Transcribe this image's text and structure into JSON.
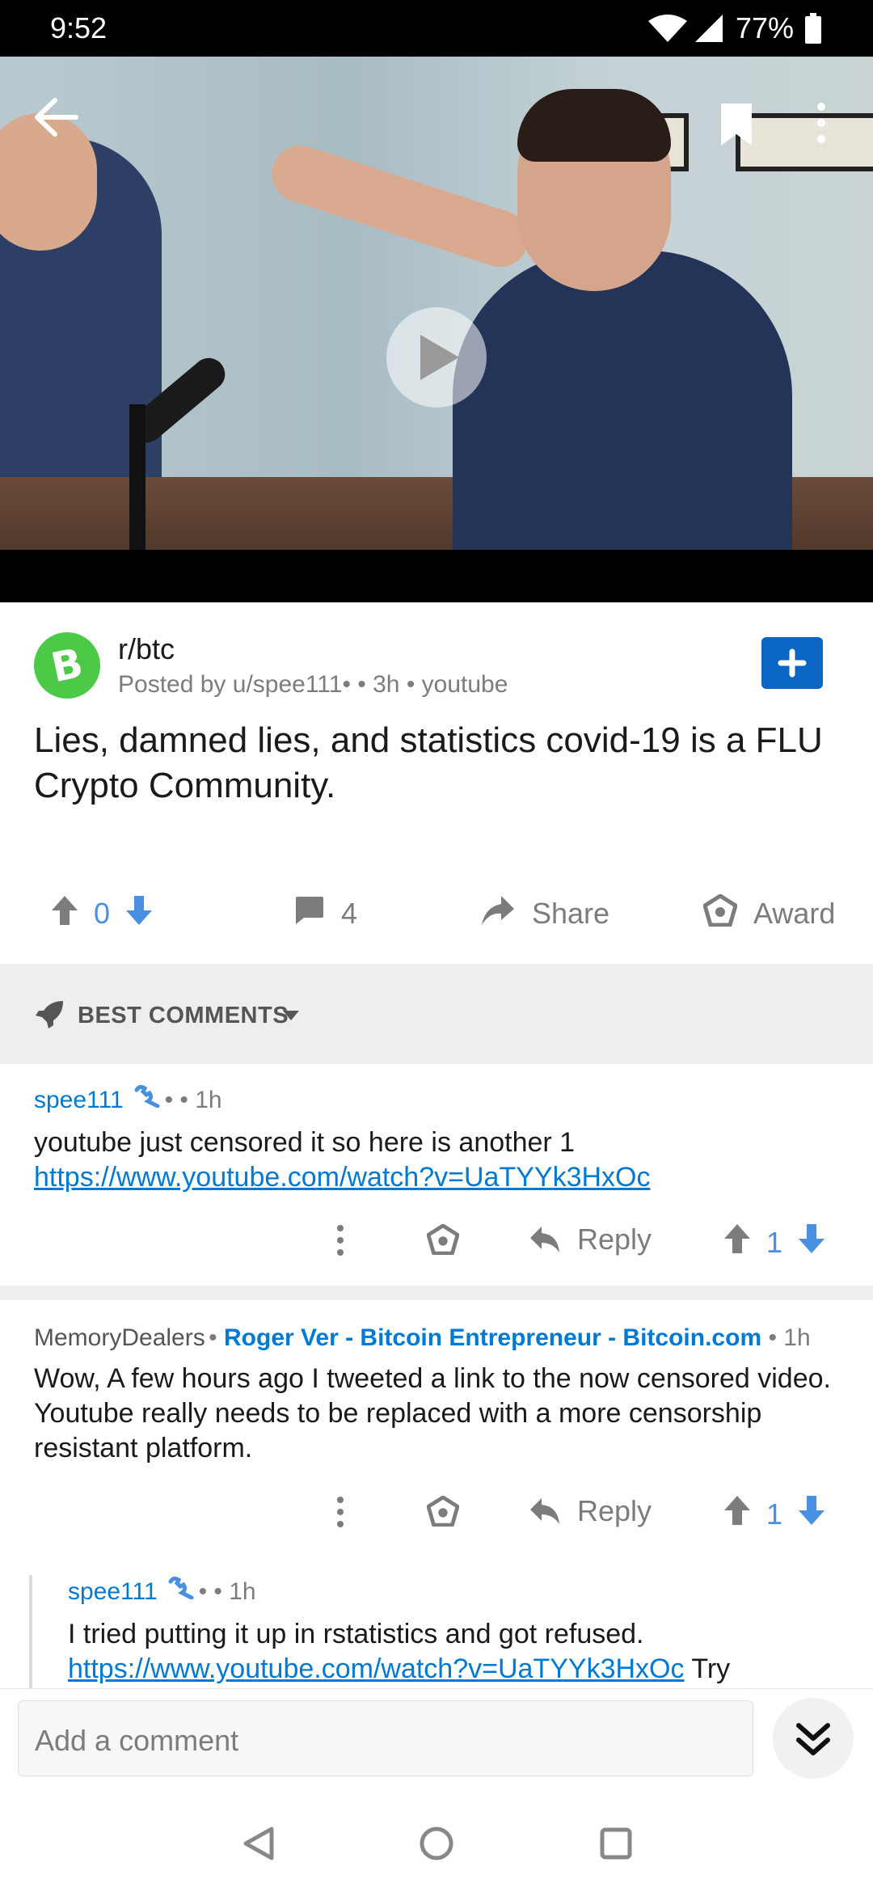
{
  "status_bar": {
    "time": "9:52",
    "battery": "77%"
  },
  "video": {
    "play_icon": "play-icon",
    "back_icon": "arrow-left-icon",
    "bookmark_icon": "bookmark-icon",
    "more_icon": "more-vertical-icon"
  },
  "post": {
    "subreddit": "r/btc",
    "meta_prefix": "Posted by u/spee111",
    "meta_suffix": " • 3h • youtube",
    "title": "Lies, damned lies, and statistics covid-19 is a FLU Crypto Community.",
    "votes": "0",
    "comments": "4",
    "share_label": "Share",
    "award_label": "Award"
  },
  "sort": {
    "label": "BEST COMMENTS"
  },
  "comments": [
    {
      "author": "spee111",
      "time": " • 1h",
      "text": "youtube just censored it so here is another 1",
      "link": "https://www.youtube.com/watch?v=UaTYYk3HxOc",
      "reply_label": "Reply",
      "votes": "1"
    },
    {
      "author": "MemoryDealers",
      "flair": "Roger Ver - Bitcoin Entrepreneur - Bitcoin.com",
      "time": " • 1h",
      "text": "Wow, A few hours ago I tweeted a link to the now censored video.  Youtube really needs to be replaced with a more censorship resistant platform.",
      "reply_label": "Reply",
      "votes": "1"
    },
    {
      "author": "spee111",
      "time": " • 1h",
      "text": "I tried putting it up in rstatistics and got refused.",
      "link": "https://www.youtube.com/watch?v=UaTYYk3HxOc",
      "trailing": " Try"
    }
  ],
  "composer": {
    "placeholder": "Add a comment"
  },
  "colors": {
    "accent": "#0079d3",
    "vote_blue": "#4a90e2",
    "join": "#0a66c2",
    "sub_icon": "#4cc947"
  }
}
